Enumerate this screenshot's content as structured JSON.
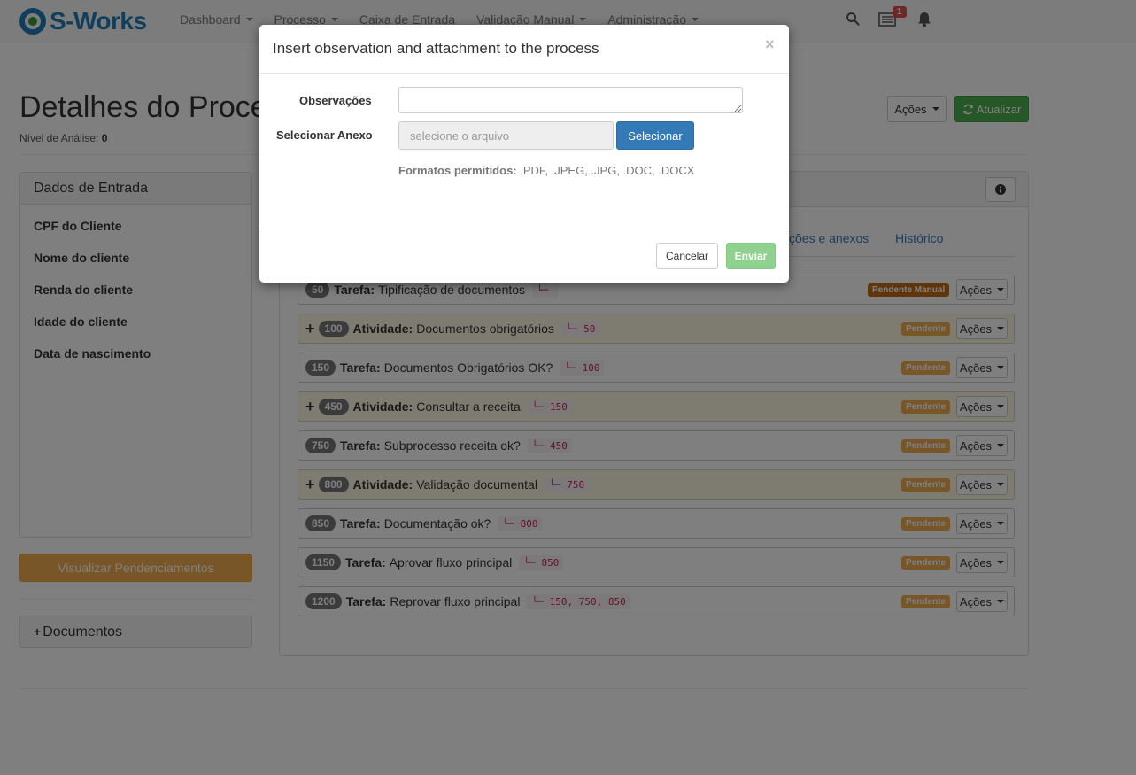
{
  "navbar": {
    "brand": "S-Works",
    "menu": [
      "Dashboard",
      "Processo",
      "Caixa de Entrada",
      "Validação Manual",
      "Administração"
    ],
    "tasks_badge": "1",
    "icons": {
      "search": "search-icon",
      "tasks": "tasks-list-icon",
      "notifications": "bell-icon"
    }
  },
  "page": {
    "title": "Detalhes do Proce",
    "analysis_label": "Nível de Análise:",
    "analysis_value": "0",
    "acoes_label": "Ações",
    "refresh_label": "Atualizar"
  },
  "dados_entrada": {
    "title": "Dados de Entrada",
    "fields": [
      "CPF do Cliente",
      "Nome do cliente",
      "Renda do cliente",
      "Idade do cliente",
      "Data de nascimento"
    ]
  },
  "pendenciamentos_button": "Visualizar Pendenciamentos",
  "documentos_panel": "Documentos",
  "tabs": [
    "ções e anexos",
    "Histórico"
  ],
  "tasks": [
    {
      "id": "50",
      "type": "Tarefa:",
      "name": "Tipificação de documentos",
      "deps": "",
      "status": "Pendente Manual",
      "expandable": false
    },
    {
      "id": "100",
      "type": "Atividade:",
      "name": "Documentos obrigatórios",
      "deps": "50",
      "status": "Pendente",
      "expandable": true
    },
    {
      "id": "150",
      "type": "Tarefa:",
      "name": "Documentos Obrigatórios OK?",
      "deps": "100",
      "status": "Pendente",
      "expandable": false
    },
    {
      "id": "450",
      "type": "Atividade:",
      "name": "Consultar a receita",
      "deps": "150",
      "status": "Pendente",
      "expandable": true
    },
    {
      "id": "750",
      "type": "Tarefa:",
      "name": "Subprocesso receita ok?",
      "deps": "450",
      "status": "Pendente",
      "expandable": false
    },
    {
      "id": "800",
      "type": "Atividade:",
      "name": "Validação documental",
      "deps": "750",
      "status": "Pendente",
      "expandable": true
    },
    {
      "id": "850",
      "type": "Tarefa:",
      "name": "Documentação ok?",
      "deps": "800",
      "status": "Pendente",
      "expandable": false
    },
    {
      "id": "1150",
      "type": "Tarefa:",
      "name": "Aprovar fluxo principal",
      "deps": "850",
      "status": "Pendente",
      "expandable": false
    },
    {
      "id": "1200",
      "type": "Tarefa:",
      "name": "Reprovar fluxo principal",
      "deps": "150, 750, 850",
      "status": "Pendente",
      "expandable": false
    }
  ],
  "task_actions_label": "Ações",
  "modal": {
    "title": "Insert observation and attachment to the process",
    "close": "×",
    "obs_label": "Observações",
    "obs_value": "",
    "attach_label": "Selecionar Anexo",
    "file_placeholder": "selecione o arquivo",
    "select_button": "Selecionar",
    "formats_label": "Formatos permitidos:",
    "formats_value": ".PDF, .JPEG, .JPG, .DOC, .DOCX",
    "cancel": "Cancelar",
    "submit": "Enviar"
  },
  "colors": {
    "brand": "#1e7fb8",
    "primary": "#337ab7",
    "success": "#4cae4c",
    "warning": "#f0ad4e",
    "danger": "#d9534f",
    "pending_manual": "#c16a12"
  }
}
